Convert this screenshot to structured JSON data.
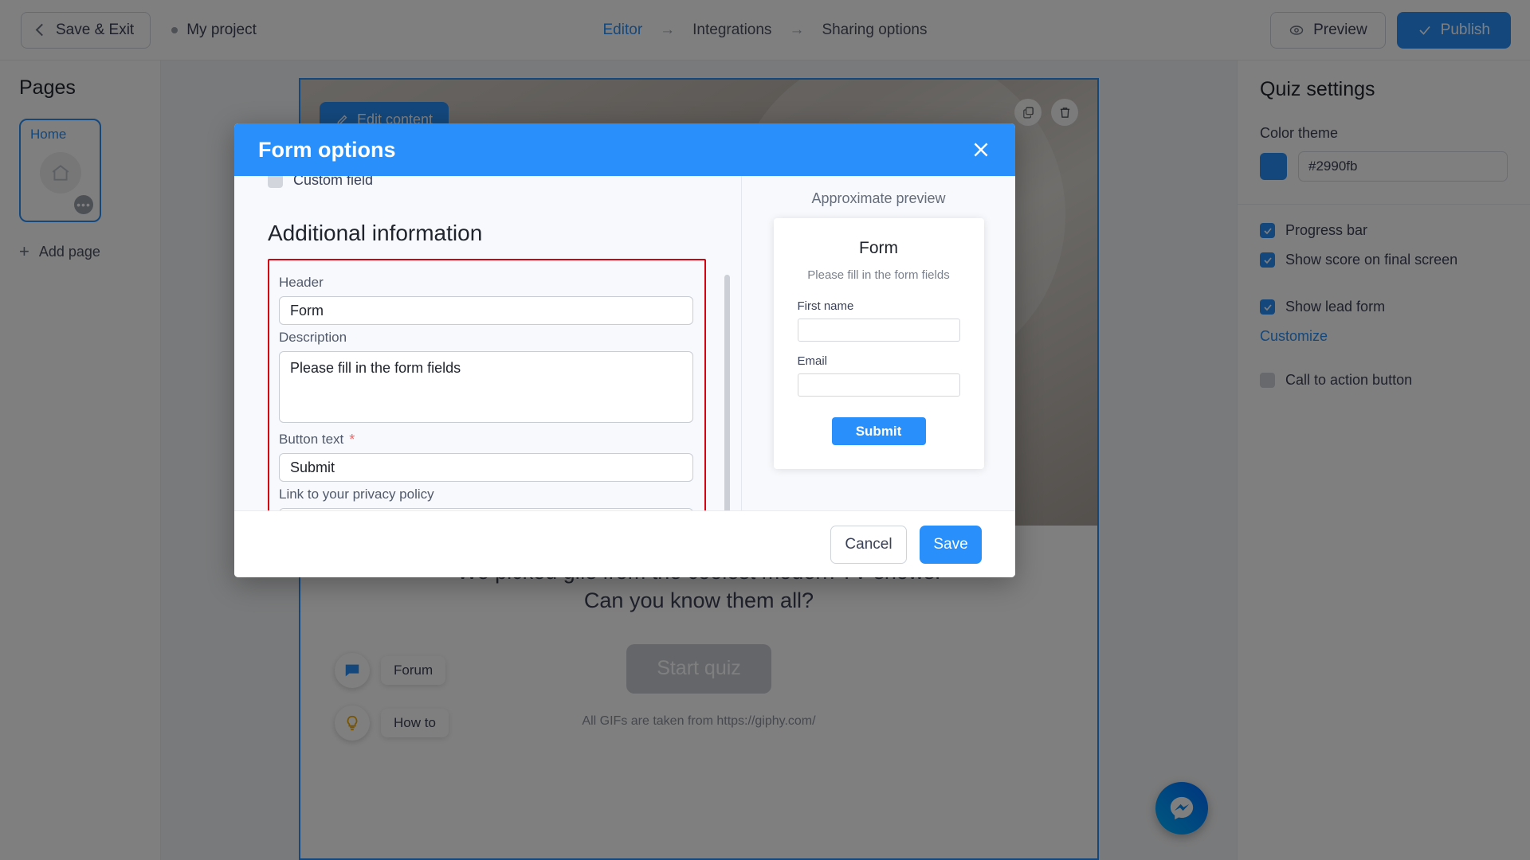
{
  "topbar": {
    "save_exit": "Save & Exit",
    "project_name": "My project",
    "breadcrumbs": [
      {
        "label": "Editor",
        "active": true
      },
      {
        "label": "Integrations",
        "active": false
      },
      {
        "label": "Sharing options",
        "active": false
      }
    ],
    "breadcrumb_arrow": "→",
    "preview": "Preview",
    "publish": "Publish"
  },
  "sidebar": {
    "title": "Pages",
    "page_card": {
      "label": "Home",
      "menu_dots": "•••"
    },
    "add_page": "Add page"
  },
  "canvas": {
    "edit_content": "Edit content",
    "quiz_line_1": "We picked gifs from the coolest modern TV shows.",
    "quiz_line_2": "Can you know them all?",
    "start_quiz": "Start quiz",
    "gif_note": "All GIFs are taken from https://giphy.com/"
  },
  "helpers": {
    "forum": "Forum",
    "how_to": "How to"
  },
  "quiz_settings": {
    "title": "Quiz settings",
    "color_theme_label": "Color theme",
    "color_theme_value": "#2990fb",
    "accent_color": "#2990fb",
    "options": [
      {
        "label": "Progress bar",
        "checked": true
      },
      {
        "label": "Show score on final screen",
        "checked": true
      },
      {
        "label": "Show lead form",
        "checked": true
      },
      {
        "label": "Call to action button",
        "checked": false
      }
    ],
    "customize_link": "Customize"
  },
  "modal": {
    "title": "Form options",
    "close_icon": "close-icon",
    "custom_field_label": "Custom field",
    "custom_field_checked": false,
    "section_heading": "Additional information",
    "fields": [
      {
        "label": "Header",
        "value": "Form",
        "required": false,
        "type": "text"
      },
      {
        "label": "Description",
        "value": "Please fill in the form fields",
        "required": false,
        "type": "textarea"
      },
      {
        "label": "Button text",
        "value": "Submit",
        "required": true,
        "type": "text"
      },
      {
        "label": "Link to your privacy policy",
        "value": "",
        "required": false,
        "type": "text"
      }
    ],
    "highlight_color": "#d40511",
    "preview": {
      "caption": "Approximate preview",
      "form_title": "Form",
      "form_subtitle": "Please fill in the form fields",
      "field_1_label": "First name",
      "field_1_value": "",
      "field_2_label": "Email",
      "field_2_value": "",
      "submit_label": "Submit"
    },
    "footer": {
      "cancel": "Cancel",
      "save": "Save"
    }
  }
}
